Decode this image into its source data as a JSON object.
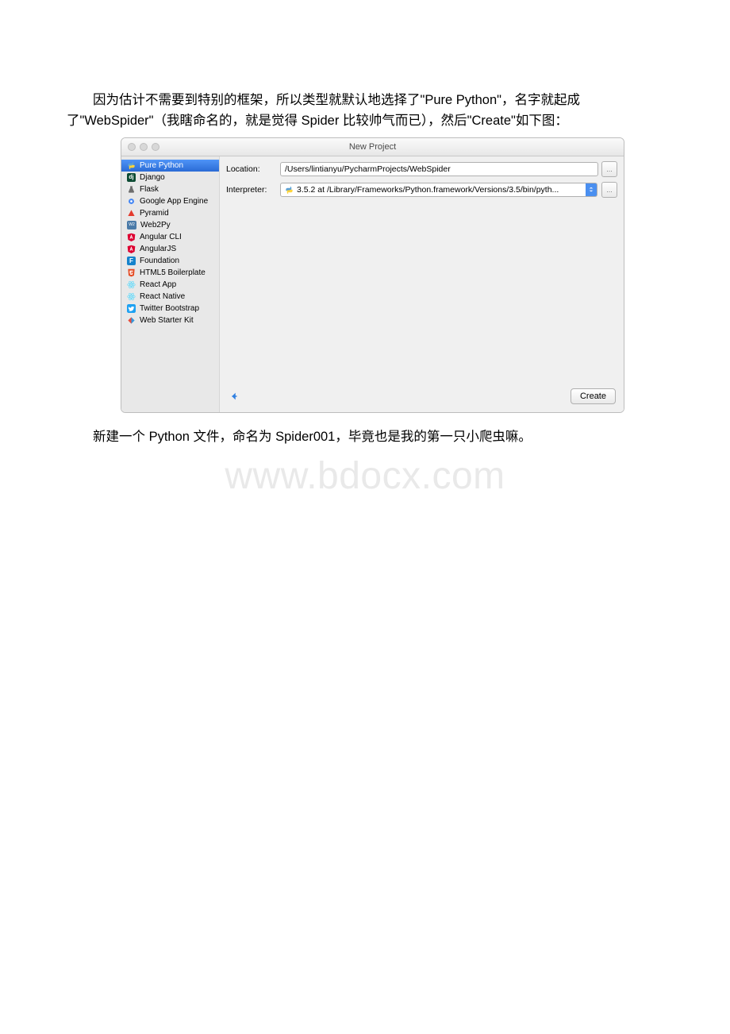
{
  "text": {
    "para1": "因为估计不需要到特别的框架，所以类型就默认地选择了\"Pure Python\"，名字就起成了\"WebSpider\"（我瞎命名的，就是觉得 Spider 比较帅气而已），然后\"Create\"如下图：",
    "para2": "新建一个 Python 文件，命名为 Spider001，毕竟也是我的第一只小爬虫嘛。",
    "watermark": "www.bdocx.com"
  },
  "dialog": {
    "title": "New Project",
    "sidebar": [
      {
        "label": "Pure Python"
      },
      {
        "label": "Django"
      },
      {
        "label": "Flask"
      },
      {
        "label": "Google App Engine"
      },
      {
        "label": "Pyramid"
      },
      {
        "label": "Web2Py"
      },
      {
        "label": "Angular CLI"
      },
      {
        "label": "AngularJS"
      },
      {
        "label": "Foundation"
      },
      {
        "label": "HTML5 Boilerplate"
      },
      {
        "label": "React App"
      },
      {
        "label": "React Native"
      },
      {
        "label": "Twitter Bootstrap"
      },
      {
        "label": "Web Starter Kit"
      }
    ],
    "form": {
      "location_label": "Location:",
      "location_value": "/Users/lintianyu/PycharmProjects/WebSpider",
      "interpreter_label": "Interpreter:",
      "interpreter_value": "3.5.2 at /Library/Frameworks/Python.framework/Versions/3.5/bin/pyth...",
      "ellipsis": "...",
      "create": "Create"
    }
  }
}
